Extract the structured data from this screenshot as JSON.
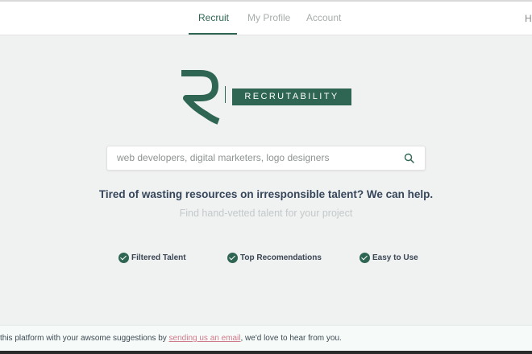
{
  "nav": {
    "tabs": [
      {
        "label": "Recruit",
        "active": true
      },
      {
        "label": "My Profile",
        "active": false
      },
      {
        "label": "Account",
        "active": false
      }
    ],
    "edge_text": "H"
  },
  "logo": {
    "wordmark": "RECRUTABILITY",
    "mark_icon": "recrutability-r-logo",
    "brand_color": "#2f6653"
  },
  "search": {
    "placeholder": "web developers, digital marketers, logo designers",
    "value": "",
    "icon": "search-icon"
  },
  "hero": {
    "headline": "Tired of wasting resources on irresponsible talent? We can help.",
    "subline": "Find hand-vetted talent for your project"
  },
  "features": [
    {
      "label": "Filtered Talent",
      "icon": "check-circle-icon"
    },
    {
      "label": "Top Recomendations",
      "icon": "check-circle-icon"
    },
    {
      "label": "Easy to Use",
      "icon": "check-circle-icon"
    }
  ],
  "footer": {
    "before": "this platform with your awsome suggestions by ",
    "link": "sending us an email",
    "after": ", we'd love to hear from you.",
    "link_color": "#d07989"
  }
}
